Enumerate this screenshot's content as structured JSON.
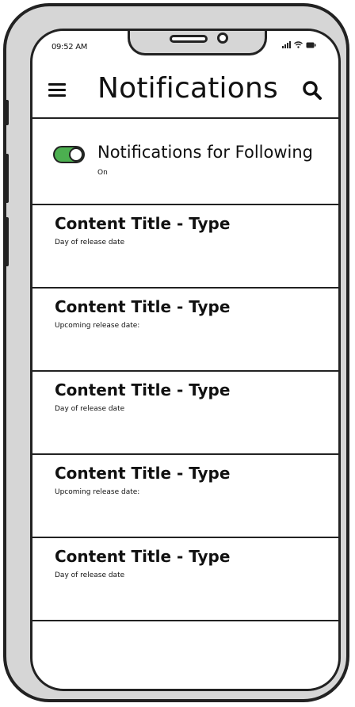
{
  "status_bar": {
    "time": "09:52 AM"
  },
  "header": {
    "title": "Notifications",
    "menu_icon": "hamburger-menu-icon",
    "search_icon": "magnifier-search-icon"
  },
  "follow_setting": {
    "label": "Notifications for Following",
    "status": "On",
    "enabled": true,
    "toggle_color": "#4caf50"
  },
  "content_items": [
    {
      "title": "Content Title - Type",
      "subtitle": "Day of release date"
    },
    {
      "title": "Content Title - Type",
      "subtitle": "Upcoming release date:"
    },
    {
      "title": "Content Title - Type",
      "subtitle": "Day of release date"
    },
    {
      "title": "Content Title - Type",
      "subtitle": "Upcoming release date:"
    },
    {
      "title": "Content Title - Type",
      "subtitle": "Day of release date"
    }
  ]
}
